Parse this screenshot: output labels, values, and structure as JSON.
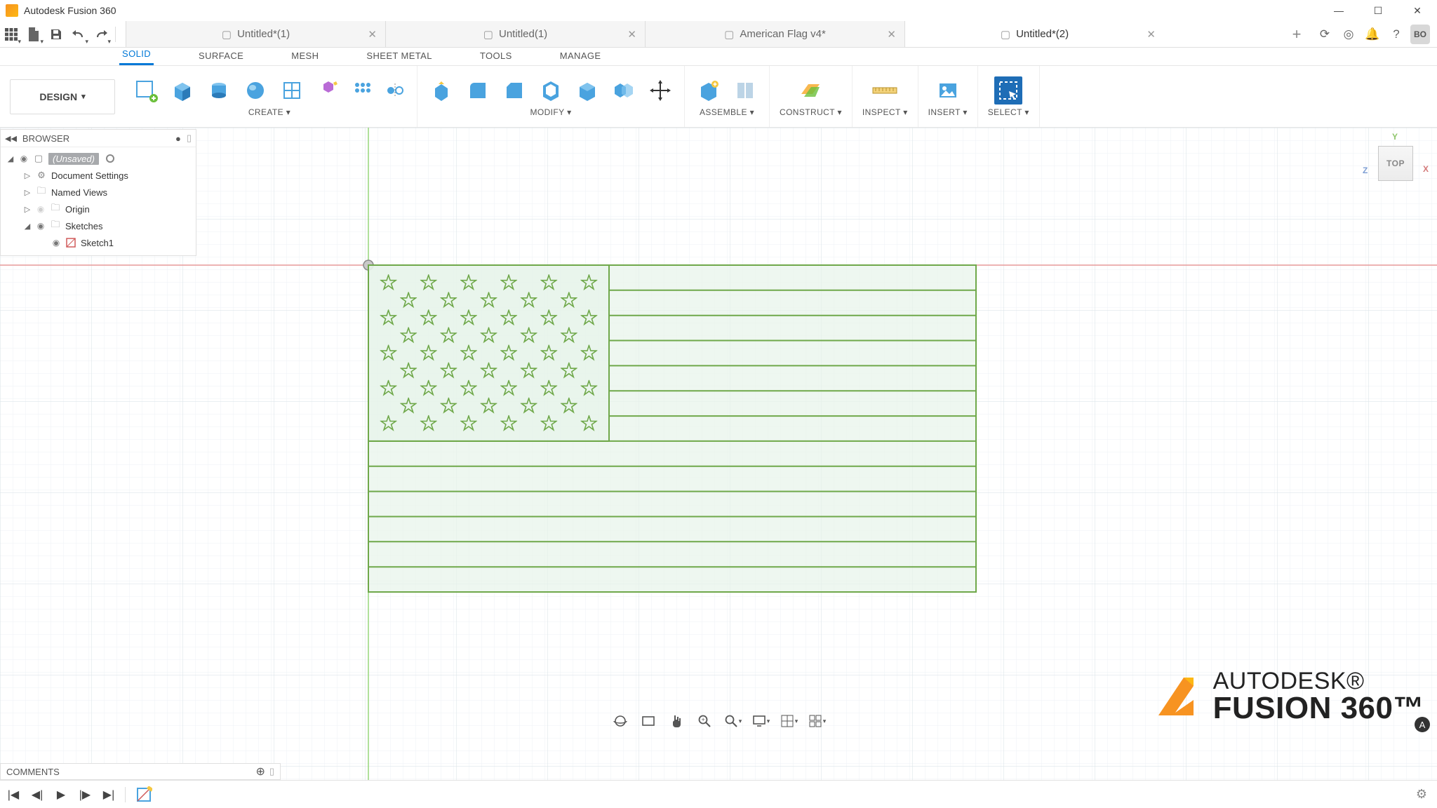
{
  "app": {
    "title": "Autodesk Fusion 360",
    "user_initials": "BO"
  },
  "window_controls": {
    "min": "—",
    "max": "☐",
    "close": "✕"
  },
  "qat": {
    "grid": "⊞",
    "file": "📄",
    "save": "💾",
    "undo": "↶",
    "redo": "↷"
  },
  "doc_tabs": [
    {
      "label": "Untitled*(1)",
      "active": false
    },
    {
      "label": "Untitled(1)",
      "active": false
    },
    {
      "label": "American Flag v4*",
      "active": false
    },
    {
      "label": "Untitled*(2)",
      "active": true
    }
  ],
  "doc_tab_plus": "+",
  "right_icons": {
    "update": "⟳",
    "globe": "🌐",
    "bell": "🔔",
    "help": "?"
  },
  "workspace": {
    "label": "DESIGN"
  },
  "ribbon_tabs": [
    "SOLID",
    "SURFACE",
    "MESH",
    "SHEET METAL",
    "TOOLS",
    "MANAGE"
  ],
  "ribbon_active": "SOLID",
  "toolbar_groups": {
    "create": {
      "label": "CREATE ▾"
    },
    "modify": {
      "label": "MODIFY ▾"
    },
    "assemble": {
      "label": "ASSEMBLE ▾"
    },
    "construct": {
      "label": "CONSTRUCT ▾"
    },
    "inspect": {
      "label": "INSPECT ▾"
    },
    "insert": {
      "label": "INSERT ▾"
    },
    "select": {
      "label": "SELECT ▾"
    }
  },
  "browser": {
    "title": "BROWSER",
    "root": "(Unsaved)",
    "nodes": [
      {
        "label": "Document Settings",
        "icon": "gear",
        "indent": 1,
        "expand": "▷"
      },
      {
        "label": "Named Views",
        "icon": "folder",
        "indent": 1,
        "expand": "▷"
      },
      {
        "label": "Origin",
        "icon": "folder",
        "indent": 1,
        "expand": "▷",
        "dimeye": true
      },
      {
        "label": "Sketches",
        "icon": "folder",
        "indent": 1,
        "expand": "◢"
      },
      {
        "label": "Sketch1",
        "icon": "sketch",
        "indent": 2,
        "expand": ""
      }
    ]
  },
  "viewcube": {
    "face": "TOP",
    "x": "X",
    "y": "Y",
    "z": "Z"
  },
  "navbar": [
    "orbit",
    "fit",
    "pan",
    "zoom-window",
    "zoom",
    "display",
    "grid",
    "layout"
  ],
  "comments": {
    "label": "COMMENTS",
    "plus": "+"
  },
  "timeline": {
    "skip_start": "⏮",
    "step_back": "◀",
    "play": "▶",
    "step_fwd": "▶",
    "skip_end": "⏭",
    "gear": "⚙"
  },
  "watermark": {
    "l1": "AUTODESK®",
    "l2": "FUSION 360™"
  }
}
